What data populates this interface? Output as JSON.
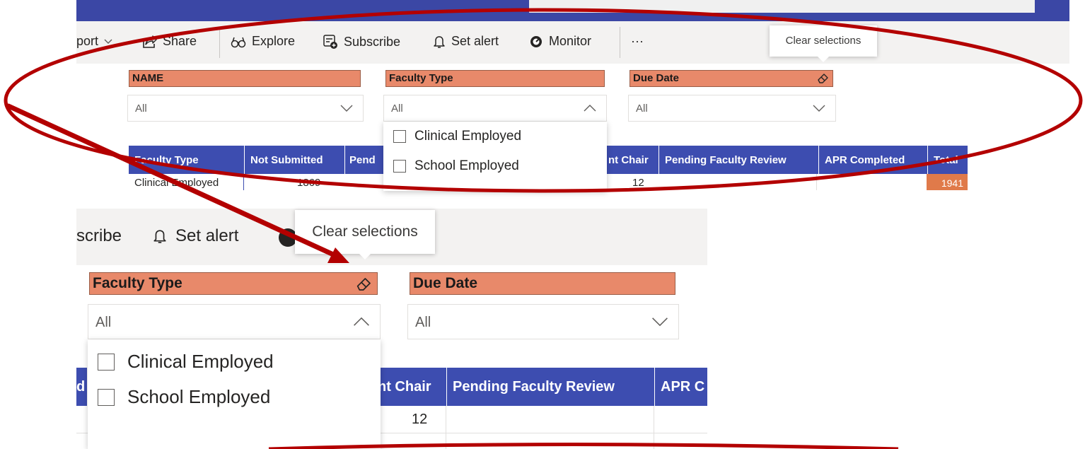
{
  "toolbar": {
    "export_partial": "port",
    "share_label": "Share",
    "explore_label": "Explore",
    "subscribe_label": "Subscribe",
    "set_alert_label": "Set alert",
    "monitor_label": "Monitor",
    "more_label": "···",
    "tooltip": "Clear selections"
  },
  "slicers": {
    "name": {
      "title": "NAME",
      "value": "All"
    },
    "faculty_type": {
      "title": "Faculty Type",
      "value": "All",
      "options": [
        "Clinical Employed",
        "School Employed"
      ]
    },
    "due_date": {
      "title": "Due Date",
      "value": "All"
    }
  },
  "table": {
    "headers": [
      "Faculty Type",
      "Not Submitted",
      "Pend",
      "nt Chair",
      "Pending Faculty Review",
      "APR Completed",
      "Total"
    ],
    "row": {
      "faculty_type": "Clinical Employed",
      "not_submitted": "1869",
      "chair": "12",
      "total": "1941"
    }
  },
  "zoom": {
    "subscribe_partial": "scribe",
    "set_alert_label": "Set alert",
    "tooltip": "Clear selections",
    "faculty_type_title": "Faculty Type",
    "due_date_title": "Due Date",
    "faculty_value": "All",
    "due_value": "All",
    "options": [
      "Clinical Employed",
      "School Employed"
    ],
    "headers": [
      "d",
      "nt Chair",
      "Pending Faculty Review",
      "APR C"
    ],
    "chair_value": "12"
  },
  "colors": {
    "accent": "#3b47a5",
    "slicer_header": "#e8896a",
    "table_header": "#3d4db0",
    "annotation": "#b30000",
    "total_cell": "#e07a4a"
  }
}
